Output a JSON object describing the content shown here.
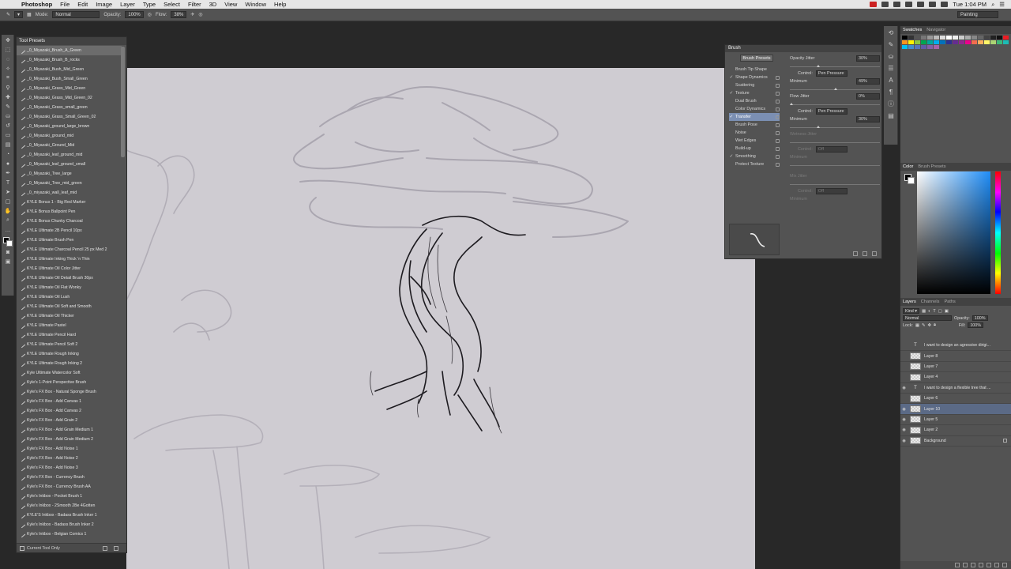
{
  "menubar": {
    "app": "Photoshop",
    "items": [
      "File",
      "Edit",
      "Image",
      "Layer",
      "Type",
      "Select",
      "Filter",
      "3D",
      "View",
      "Window",
      "Help"
    ],
    "clock": "Tue 1:04 PM"
  },
  "options": {
    "mode_label": "Mode:",
    "mode_value": "Normal",
    "opacity_label": "Opacity:",
    "opacity_value": "100%",
    "flow_label": "Flow:",
    "flow_value": "38%",
    "workspace": "Painting"
  },
  "presets": {
    "tab": "Tool Presets",
    "items": [
      "_0_Miyazaki_Brush_A_Green",
      "_0_Miyazaki_Brush_B_rocks",
      "_0_Miyazaki_Bush_Mid_Green",
      "_0_Miyazaki_Bush_Small_Green",
      "_0_Miyazaki_Grass_Mid_Green",
      "_0_Miyazaki_Grass_Mid_Green_02",
      "_0_Miyazaki_Grass_small_green",
      "_0_Miyazaki_Grass_Small_Green_02",
      "_0_Miyazaki_ground_large_brown",
      "_0_Miyazaki_ground_mid",
      "_0_Miyazaki_Ground_Mid",
      "_0_Miyazaki_leaf_ground_mid",
      "_0_Miyazaki_leaf_ground_small",
      "_0_Miyazaki_Tree_large",
      "_0_Miyazaki_Tree_mid_green",
      "_0_miyazaki_wall_leaf_mid",
      "KYLE Bonus 1 - Big Red Marker",
      "KYLE Bonus Ballpoint Pen",
      "KYLE Bonus Chunky Charcoal",
      "KYLE Ultimate 2B Pencil 10px",
      "KYLE Ultimate Brush Pen",
      "KYLE Ultimate Charcoal Pencil 25 px Med 2",
      "KYLE Ultimate Inking Thick 'n Thin",
      "KYLE Ultimate Oil Color Jitter",
      "KYLE Ultimate Oil Detail Brush 30px",
      "KYLE Ultimate Oil Flat Wonky",
      "KYLE Ultimate Oil Lush",
      "KYLE Ultimate Oil Soft and Smooth",
      "KYLE Ultimate Oil Thicker",
      "KYLE Ultimate Pastel",
      "KYLE Ultimate Pencil Hard",
      "KYLE Ultimate Pencil Soft 2",
      "KYLE Ultimate Rough Inking",
      "KYLE Ultimate Rough Inking 2",
      "Kyle Ultimate Watercolor Soft",
      "Kyle's 1-Point Perspective Brush",
      "Kyle's FX Box - Natural Sponge Brush",
      "Kyle's FX Box - Add Canvas 1",
      "Kyle's FX Box - Add Canvas 2",
      "Kyle's FX Box - Add Grain 2",
      "Kyle's FX Box - Add Grain Medium 1",
      "Kyle's FX Box - Add Grain Medium 2",
      "Kyle's FX Box - Add Noise 1",
      "Kyle's FX Box - Add Noise 2",
      "Kyle's FX Box - Add Noise 3",
      "Kyle's FX Box - Currency Brush",
      "Kyle's FX Box - Currency Brush AA",
      "Kyle's Inkbox - Pocket Brush 1",
      "Kyle's Inkbox - 2Smooth 2Be 4Gotten",
      "KYLE'S Inkbox - Badass Brush Inker 1",
      "Kyle's Inkbox - Badass Brush Inker 2",
      "Kyle's Inkbox - Belgian Comics 1"
    ],
    "footer": "Current Tool Only"
  },
  "brush": {
    "title": "Brush",
    "presets_button": "Brush Presets",
    "options": [
      {
        "label": "Brush Tip Shape",
        "check": "",
        "header": true,
        "sel": false
      },
      {
        "label": "Shape Dynamics",
        "check": "✓",
        "header": false,
        "sel": false
      },
      {
        "label": "Scattering",
        "check": "",
        "header": false,
        "sel": false
      },
      {
        "label": "Texture",
        "check": "✓",
        "header": false,
        "sel": false
      },
      {
        "label": "Dual Brush",
        "check": "",
        "header": false,
        "sel": false
      },
      {
        "label": "Color Dynamics",
        "check": "",
        "header": false,
        "sel": false
      },
      {
        "label": "Transfer",
        "check": "✓",
        "header": false,
        "sel": true
      },
      {
        "label": "Brush Pose",
        "check": "",
        "header": false,
        "sel": false
      },
      {
        "label": "Noise",
        "check": "",
        "header": false,
        "sel": false
      },
      {
        "label": "Wet Edges",
        "check": "",
        "header": false,
        "sel": false
      },
      {
        "label": "Build-up",
        "check": "",
        "header": false,
        "sel": false
      },
      {
        "label": "Smoothing",
        "check": "✓",
        "header": false,
        "sel": false
      },
      {
        "label": "Protect Texture",
        "check": "",
        "header": false,
        "sel": false
      }
    ],
    "opacity_jitter_label": "Opacity Jitter",
    "opacity_jitter_value": "30%",
    "control_label": "Control:",
    "control_value": "Pen Pressure",
    "minimum_label": "Minimum",
    "minimum_value_1": "49%",
    "minimum_level_1": 0.49,
    "opacity_jitter_level": 0.3,
    "flow_jitter_label": "Flow Jitter",
    "flow_jitter_value": "0%",
    "control_value_2": "Pen Pressure",
    "minimum_value_2": "30%",
    "minimum_level_2": 0.3,
    "wetness_label": "Wetness Jitter",
    "control_off": "Off",
    "mix_label": "Mix Jitter"
  },
  "swatches": {
    "tabs": [
      "Swatches",
      "Navigator"
    ],
    "colors": [
      "#000000",
      "#333333",
      "#555555",
      "#777777",
      "#999999",
      "#bbbbbb",
      "#dddddd",
      "#ffffff",
      "#eeeeee",
      "#cccccc",
      "#aaaaaa",
      "#888888",
      "#666666",
      "#444444",
      "#222222",
      "#111111",
      "#ed1c24",
      "#f7941d",
      "#fff200",
      "#8dc63f",
      "#00a651",
      "#00a99d",
      "#00aeef",
      "#0072bc",
      "#2e3192",
      "#662d91",
      "#92278f",
      "#ec008c",
      "#f26c4f",
      "#fbaf5d",
      "#fff568",
      "#acd373",
      "#3cb878",
      "#1cbbb4",
      "#00bff3",
      "#448ccb",
      "#5674b9",
      "#605ca8",
      "#855fa8",
      "#a763a8"
    ]
  },
  "color": {
    "tabs": [
      "Color",
      "Brush Presets"
    ]
  },
  "layers": {
    "tabs": [
      "Layers",
      "Channels",
      "Paths"
    ],
    "kind": "Kind",
    "blend": "Normal",
    "opacity_label": "Opacity:",
    "opacity_value": "100%",
    "lock_label": "Lock:",
    "fill_label": "Fill:",
    "fill_value": "100%",
    "items": [
      {
        "name": "I want to design an agressive dirigi...",
        "type": "text",
        "visible": false,
        "sel": false
      },
      {
        "name": "Layer 8",
        "type": "pixel",
        "visible": false,
        "sel": false
      },
      {
        "name": "Layer 7",
        "type": "pixel",
        "visible": false,
        "sel": false
      },
      {
        "name": "Layer 4",
        "type": "pixel",
        "visible": false,
        "sel": false
      },
      {
        "name": "I want to design a flexible tree that ...",
        "type": "text",
        "visible": true,
        "sel": false
      },
      {
        "name": "Layer 6",
        "type": "pixel",
        "visible": false,
        "sel": false
      },
      {
        "name": "Layer 10",
        "type": "pixel",
        "visible": true,
        "sel": true
      },
      {
        "name": "Layer 5",
        "type": "pixel",
        "visible": true,
        "sel": false
      },
      {
        "name": "Layer 2",
        "type": "pixel",
        "visible": true,
        "sel": false
      },
      {
        "name": "Background",
        "type": "pixel",
        "visible": true,
        "sel": false,
        "locked": true
      }
    ]
  }
}
